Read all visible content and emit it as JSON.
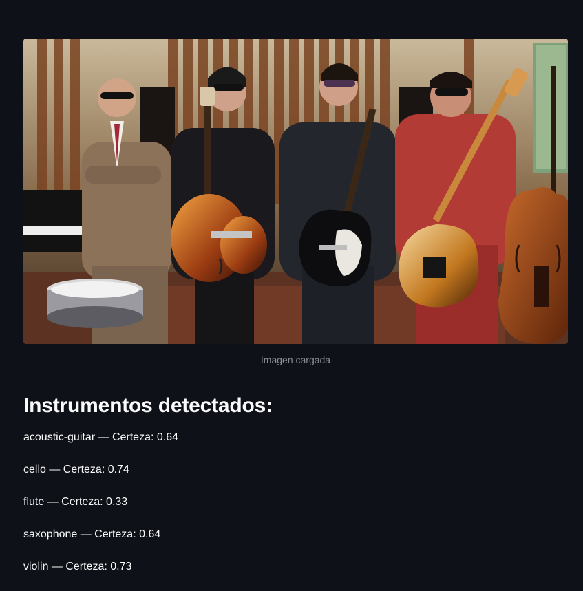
{
  "image": {
    "caption": "Imagen cargada",
    "description_icon": "band-photo"
  },
  "results": {
    "heading": "Instrumentos detectados:",
    "items": [
      {
        "label": "acoustic-guitar — Certeza: 0.64"
      },
      {
        "label": "cello — Certeza: 0.74"
      },
      {
        "label": "flute — Certeza: 0.33"
      },
      {
        "label": "saxophone — Certeza: 0.64"
      },
      {
        "label": "violin — Certeza: 0.73"
      }
    ]
  },
  "colors": {
    "background": "#0e1117",
    "text": "#fafafa",
    "caption": "#8b8d94"
  }
}
